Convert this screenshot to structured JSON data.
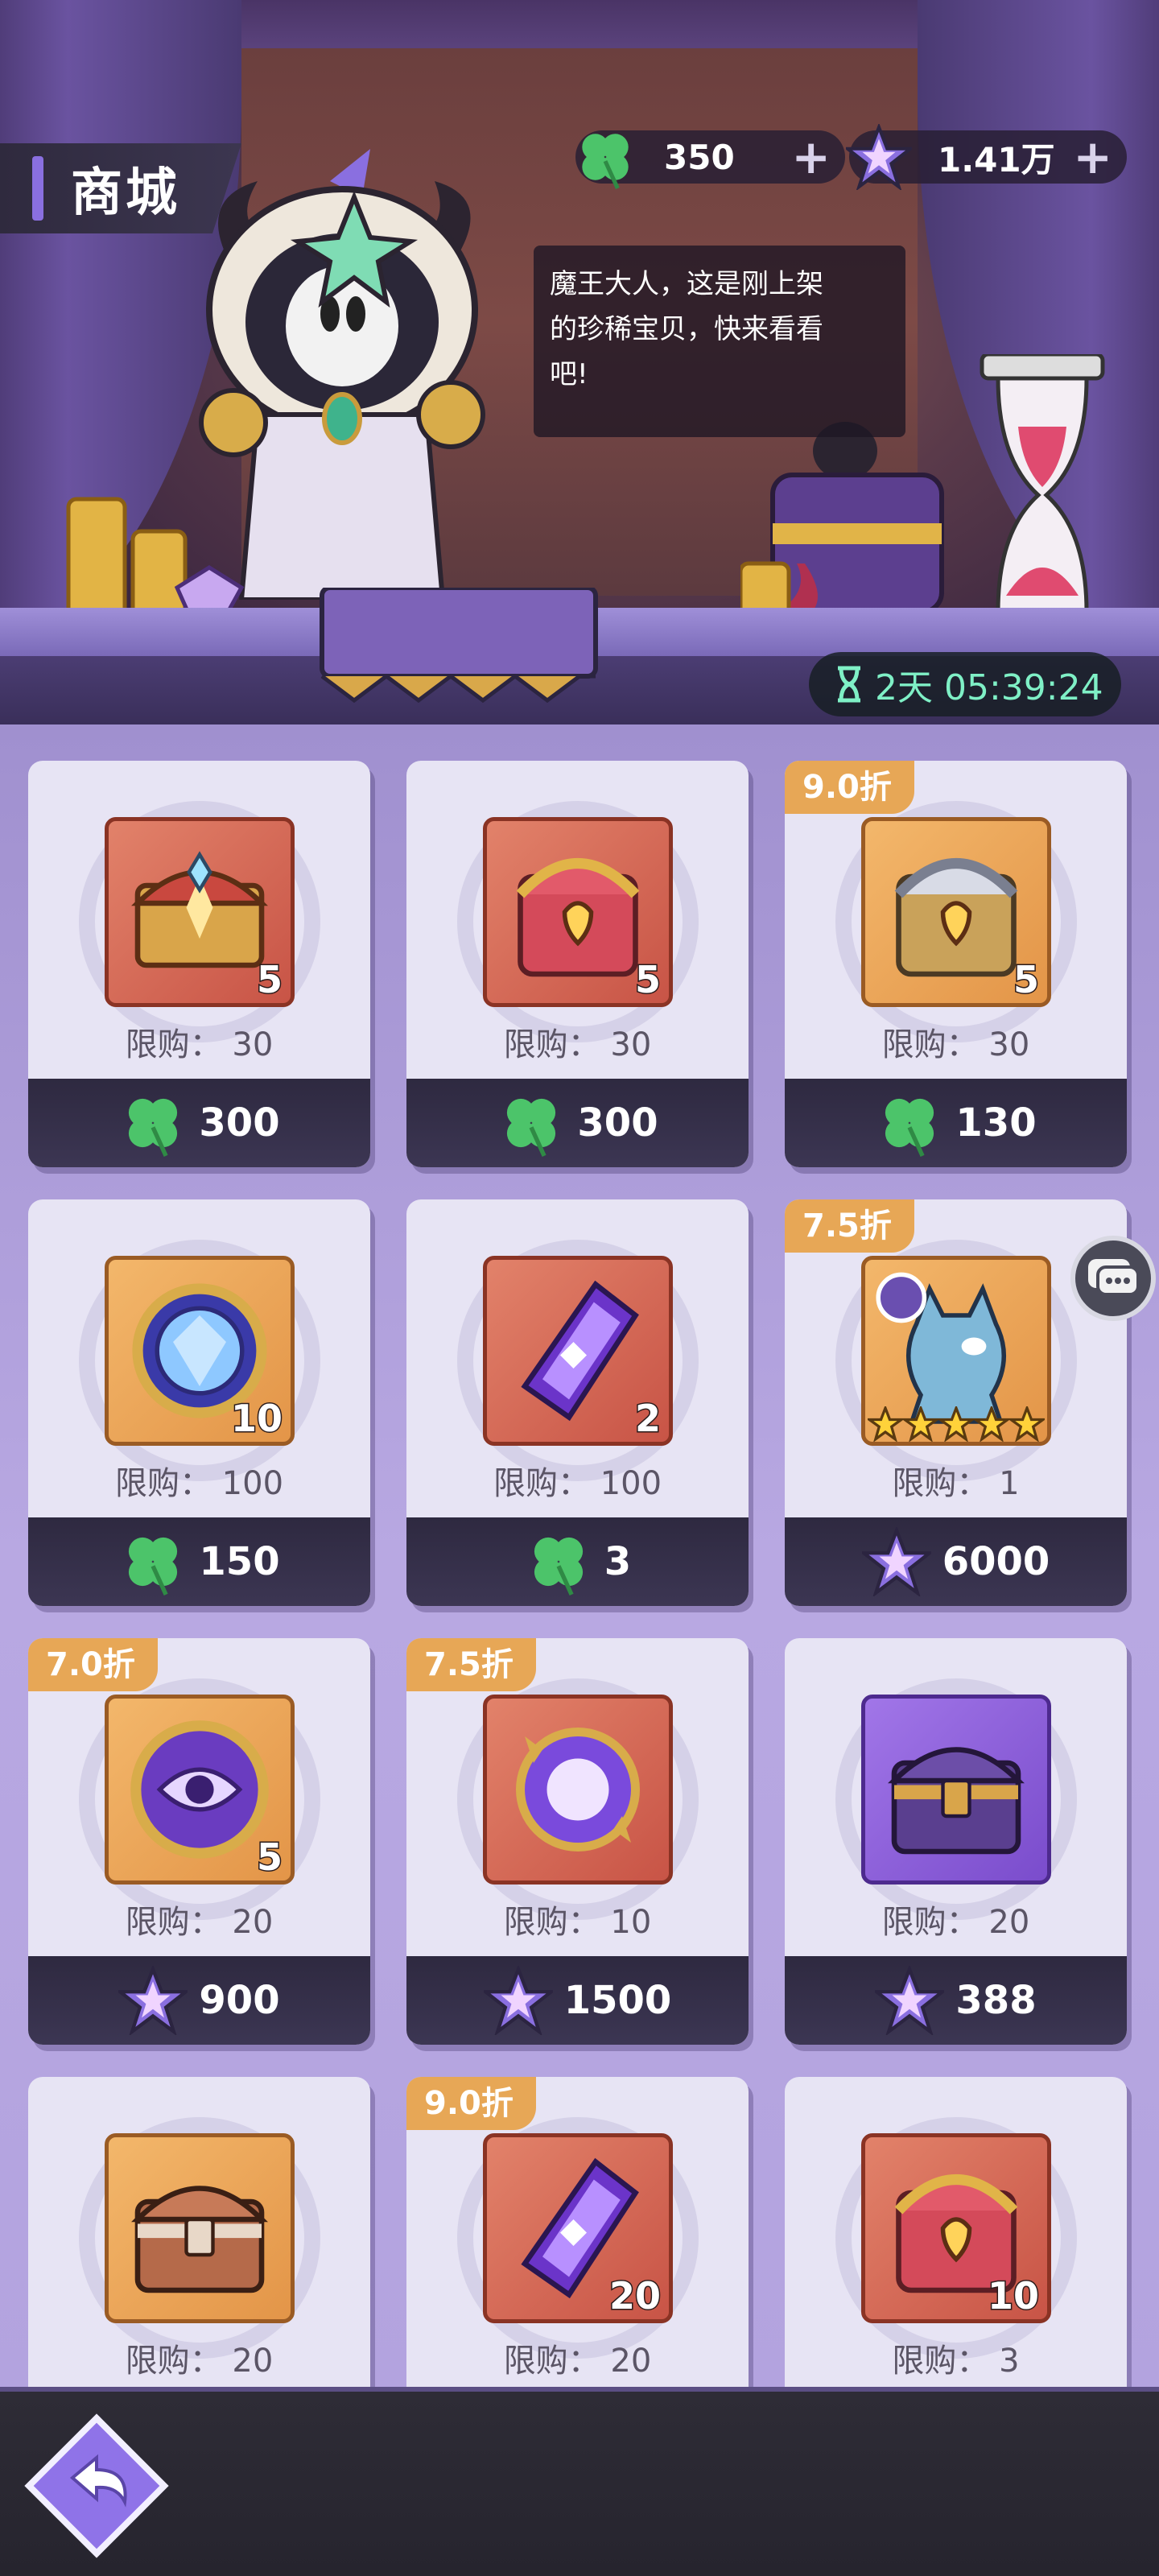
{
  "header": {
    "title": "商城",
    "clover_amount": "350",
    "star_amount": "1.41万",
    "plus_label": "+"
  },
  "dialogue": {
    "line1": "魔王大人，这是刚上架",
    "line2": "的珍稀宝贝，快来看看",
    "line3": "吧!"
  },
  "timer": {
    "text": "2天 05:39:24"
  },
  "shop_items": [
    {
      "discount": "",
      "icon": "golden-chest-icon",
      "count": "5",
      "limit_label": "限购：",
      "limit": "30",
      "currency": "clover",
      "price": "300"
    },
    {
      "discount": "",
      "icon": "royal-chest-icon",
      "count": "5",
      "limit_label": "限购：",
      "limit": "30",
      "currency": "clover",
      "price": "300"
    },
    {
      "discount": "9.0折",
      "icon": "silver-chest-icon",
      "count": "5",
      "limit_label": "限购：",
      "limit": "30",
      "currency": "clover",
      "price": "130"
    },
    {
      "discount": "",
      "icon": "blue-gem-icon",
      "count": "10",
      "limit_label": "限购：",
      "limit": "100",
      "currency": "clover",
      "price": "150"
    },
    {
      "discount": "",
      "icon": "purple-crystal-icon",
      "count": "2",
      "limit_label": "限购：",
      "limit": "100",
      "currency": "clover",
      "price": "3"
    },
    {
      "discount": "7.5折",
      "icon": "ghost-cat-icon",
      "count": "",
      "limit_label": "限购：",
      "limit": "1",
      "currency": "star",
      "price": "6000"
    },
    {
      "discount": "7.0折",
      "icon": "eye-orb-icon",
      "count": "5",
      "limit_label": "限购：",
      "limit": "20",
      "currency": "star",
      "price": "900"
    },
    {
      "discount": "7.5折",
      "icon": "magic-orb-icon",
      "count": "",
      "limit_label": "限购：",
      "limit": "10",
      "currency": "star",
      "price": "1500"
    },
    {
      "discount": "",
      "icon": "purple-chest-icon",
      "count": "",
      "limit_label": "限购：",
      "limit": "20",
      "currency": "star",
      "price": "388"
    },
    {
      "discount": "",
      "icon": "wood-chest-icon",
      "count": "",
      "limit_label": "限购：",
      "limit": "20",
      "currency": "star",
      "price": ""
    },
    {
      "discount": "9.0折",
      "icon": "purple-crystal-icon",
      "count": "20",
      "limit_label": "限购：",
      "limit": "20",
      "currency": "star",
      "price": ""
    },
    {
      "discount": "",
      "icon": "royal-chest-icon",
      "count": "10",
      "limit_label": "限购：",
      "limit": "3",
      "currency": "star",
      "price": ""
    }
  ],
  "colors": {
    "accent": "#8a6fe0",
    "discount": "#e7a756",
    "timer_text": "#7ff0c6",
    "card_bg": "#e7e4f4"
  }
}
